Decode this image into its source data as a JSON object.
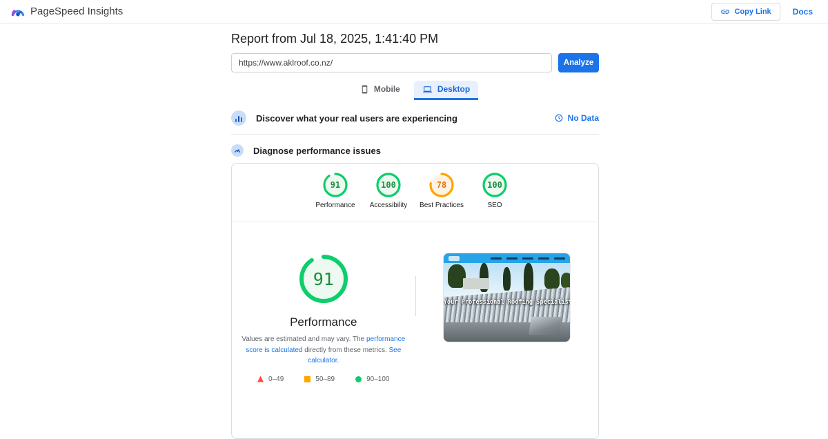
{
  "colors": {
    "accent_blue": "#1a73e8",
    "pass_green": "#0cce6b",
    "average_orange": "#ffa400",
    "fail_red": "#ff4e42"
  },
  "header": {
    "app_title": "PageSpeed Insights",
    "copy_link_label": "Copy Link",
    "docs_label": "Docs"
  },
  "report": {
    "title": "Report from Jul 18, 2025, 1:41:40 PM",
    "url_value": "https://www.aklroof.co.nz/",
    "analyze_label": "Analyze"
  },
  "tabs": {
    "mobile": "Mobile",
    "desktop": "Desktop"
  },
  "field_section": {
    "title": "Discover what your real users are experiencing",
    "status": "No Data"
  },
  "lab_section": {
    "title": "Diagnose performance issues"
  },
  "scores": {
    "categories": [
      {
        "label": "Performance",
        "score": 91
      },
      {
        "label": "Accessibility",
        "score": 100
      },
      {
        "label": "Best Practices",
        "score": 78
      },
      {
        "label": "SEO",
        "score": 100
      }
    ]
  },
  "performance_detail": {
    "score": 91,
    "title": "Performance",
    "disclaimer": {
      "text1": "Values are estimated and may vary. The ",
      "link1": "performance score is calculated",
      "text2": " directly from these metrics. ",
      "link2": "See calculator."
    },
    "legend": [
      {
        "range": "0–49",
        "color": "#ff4e42",
        "shape": "triangle"
      },
      {
        "range": "50–89",
        "color": "#ffa400",
        "shape": "square"
      },
      {
        "range": "90–100",
        "color": "#0cce6b",
        "shape": "circle"
      }
    ]
  },
  "site_preview": {
    "overlay_text": "Your Professional Roofing Specialist"
  }
}
